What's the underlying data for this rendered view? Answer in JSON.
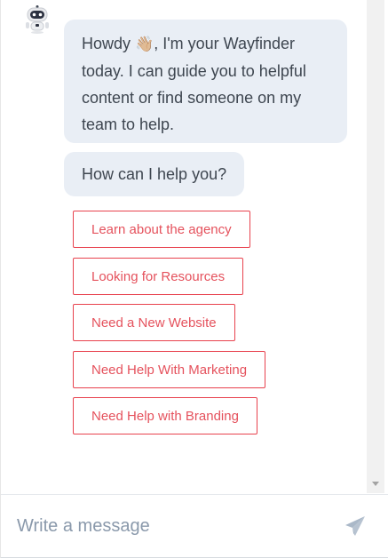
{
  "chat": {
    "greeting_before_emoji": "Howdy ",
    "greeting_emoji": "👋🏼",
    "greeting_after_emoji": ", I'm your Wayfinder today. I can guide you to helpful content or find someone on my team to help.",
    "prompt": "How can I help you?",
    "options": [
      "Learn about the agency",
      "Looking for Resources",
      "Need a New Website",
      "Need Help With Marketing",
      "Need Help with Branding"
    ]
  },
  "composer": {
    "placeholder": "Write a message"
  },
  "colors": {
    "accent": "#e8424e",
    "bubble_bg": "#e9eef5",
    "text": "#3e4650",
    "placeholder": "#8a99ab",
    "send_icon": "#aab8c8"
  },
  "icons": {
    "avatar": "robot-icon",
    "send": "send-paper-plane-icon",
    "scroll": "chevron-down-icon"
  }
}
